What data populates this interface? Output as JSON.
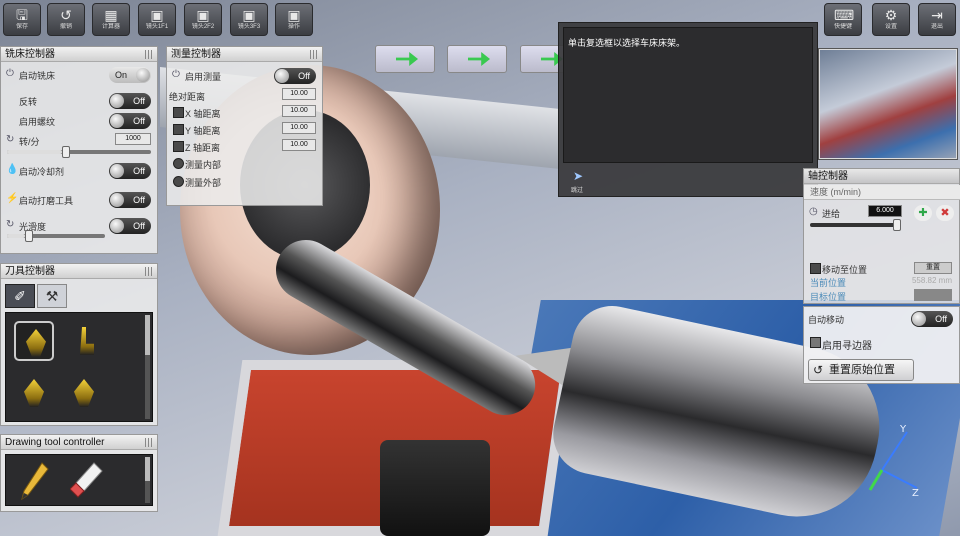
{
  "toolbar": {
    "buttons": [
      {
        "label": "保存",
        "icon": "save-icon"
      },
      {
        "label": "撤销",
        "icon": "undo-icon"
      },
      {
        "label": "计算器",
        "icon": "calculator-icon"
      },
      {
        "label": "镜头1F1",
        "icon": "camera-icon"
      },
      {
        "label": "镜头2F2",
        "icon": "camera-icon"
      },
      {
        "label": "镜头3F3",
        "icon": "camera-icon"
      },
      {
        "label": "操作",
        "icon": "camera-icon"
      },
      {
        "label": "快捷键",
        "icon": "keyboard-icon"
      },
      {
        "label": "设置",
        "icon": "gear-icon"
      },
      {
        "label": "退出",
        "icon": "exit-icon"
      }
    ]
  },
  "lathe_panel": {
    "title": "铣床控制器",
    "start_label": "启动铣床",
    "start_state": "On",
    "reverse_label": "反转",
    "reverse_state": "Off",
    "thread_label": "启用螺纹",
    "thread_state": "Off",
    "speed_label": "转/分",
    "speed_value": "1000",
    "coolant_label": "启动冷却剂",
    "coolant_state": "Off",
    "polish_label": "启动打磨工具",
    "polish_state": "Off",
    "lubricate_label": "光滑度",
    "lubricate_state": "Off"
  },
  "measure_panel": {
    "title": "测量控制器",
    "enable_label": "启用测量",
    "enable_state": "Off",
    "abs_label": "绝对距离",
    "abs_value": "10.00",
    "x_label": "X 轴距离",
    "x_value": "10.00",
    "y_label": "Y 轴距离",
    "y_value": "10.00",
    "z_label": "Z 轴距离",
    "z_value": "10.00",
    "inside_label": "测量内部",
    "outside_label": "测量外部"
  },
  "tool_panel": {
    "title": "刀具控制器"
  },
  "drawing_panel": {
    "title": "Drawing tool controller"
  },
  "message": {
    "text": "单击复选框以选择车床床架。",
    "button_label": "跳过"
  },
  "axis_panel": {
    "title": "轴控制器",
    "feed_header": "速度 (m/min)",
    "feed_label": "进给",
    "feed_value": "6.000",
    "move_label": "移动至位置",
    "reset_small": "重置",
    "current_label": "当前位置",
    "current_value": "558.82 mm",
    "target_label": "目标位置",
    "auto_move_label": "自动移动",
    "auto_move_state": "Off",
    "edge_finder_label": "启用寻边器",
    "reset_button_label": "重置原始位置"
  },
  "axes_labels": {
    "y": "Y",
    "z": "Z"
  }
}
